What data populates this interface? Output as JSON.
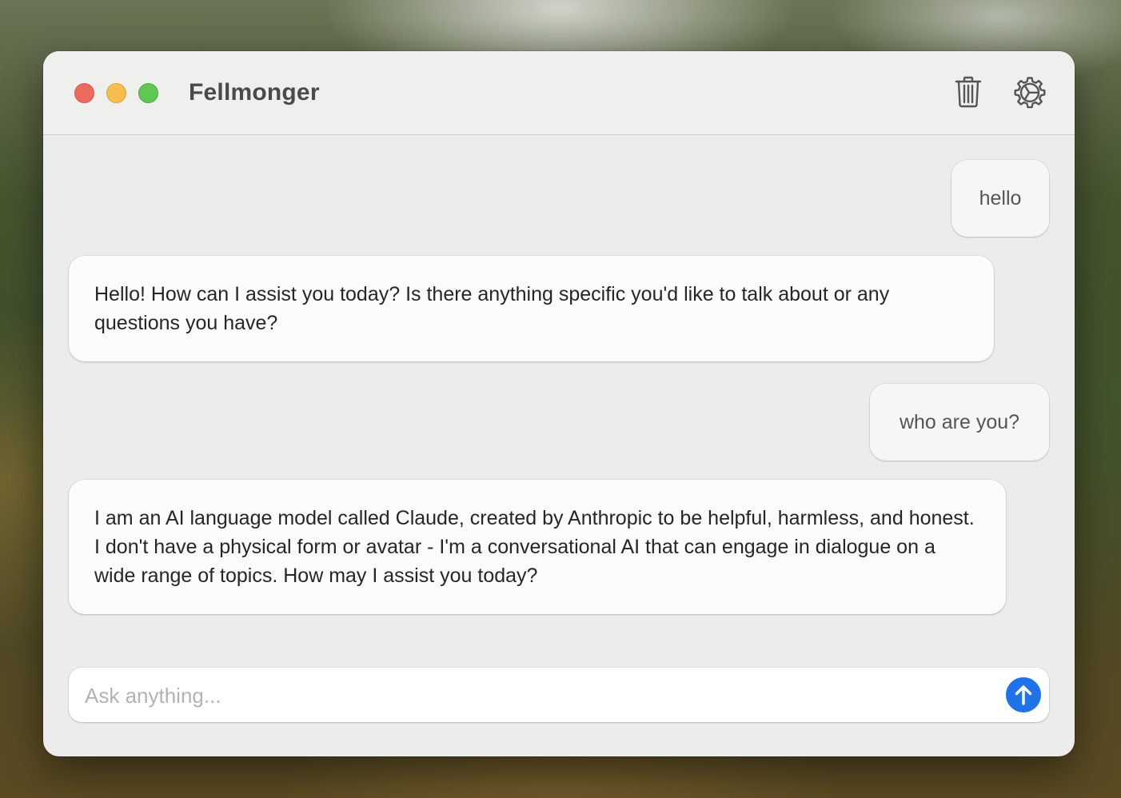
{
  "window": {
    "title": "Fellmonger"
  },
  "toolbar": {
    "clear_icon": "trash-icon",
    "settings_icon": "gear-icon"
  },
  "messages": [
    {
      "role": "user",
      "text": "hello"
    },
    {
      "role": "assistant",
      "text": "Hello! How can I assist you today? Is there anything specific you'd like to talk about or any questions you have?"
    },
    {
      "role": "user",
      "text": "who are you?"
    },
    {
      "role": "assistant",
      "text": "I am an AI language model called Claude, created by Anthropic to be helpful, harmless, and honest. I don't have a physical form or avatar - I'm a conversational AI that can engage in dialogue on a wide range of topics. How may I assist you today?"
    }
  ],
  "composer": {
    "value": "",
    "placeholder": "Ask anything...",
    "send_icon": "arrow-up-icon"
  },
  "colors": {
    "accent": "#1f73e6",
    "close": "#ee6a5f",
    "minimize": "#f5be4f",
    "zoom": "#62c655"
  }
}
